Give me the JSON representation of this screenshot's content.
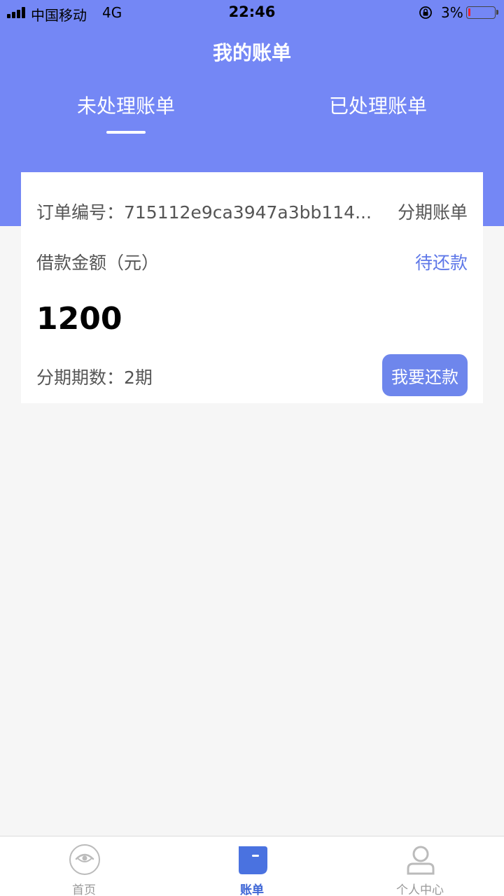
{
  "status_bar": {
    "carrier": "中国移动",
    "network": "4G",
    "time": "22:46",
    "battery_percent": "3%",
    "battery_level": 0.03,
    "icons": [
      "signal-icon",
      "orientation-lock-icon",
      "battery-icon"
    ]
  },
  "header": {
    "title": "我的账单",
    "tabs": [
      {
        "label": "未处理账单",
        "active": true
      },
      {
        "label": "已处理账单",
        "active": false
      }
    ]
  },
  "bill": {
    "order_label": "订单编号：715112e9ca3947a3bb114...",
    "order_type": "分期账单",
    "amount_label": "借款金额（元）",
    "status": "待还款",
    "amount": "1200",
    "term_label": "分期期数：2期",
    "repay_button": "我要还款"
  },
  "nav": {
    "items": [
      {
        "label": "首页",
        "icon": "home-eye-icon",
        "active": false
      },
      {
        "label": "账单",
        "icon": "bill-icon",
        "active": true
      },
      {
        "label": "个人中心",
        "icon": "user-icon",
        "active": false
      }
    ]
  },
  "colors": {
    "header_bg": "#7487f5",
    "accent": "#5f78e8",
    "button_bg": "#6e86ec",
    "nav_active": "#3e66d6"
  }
}
